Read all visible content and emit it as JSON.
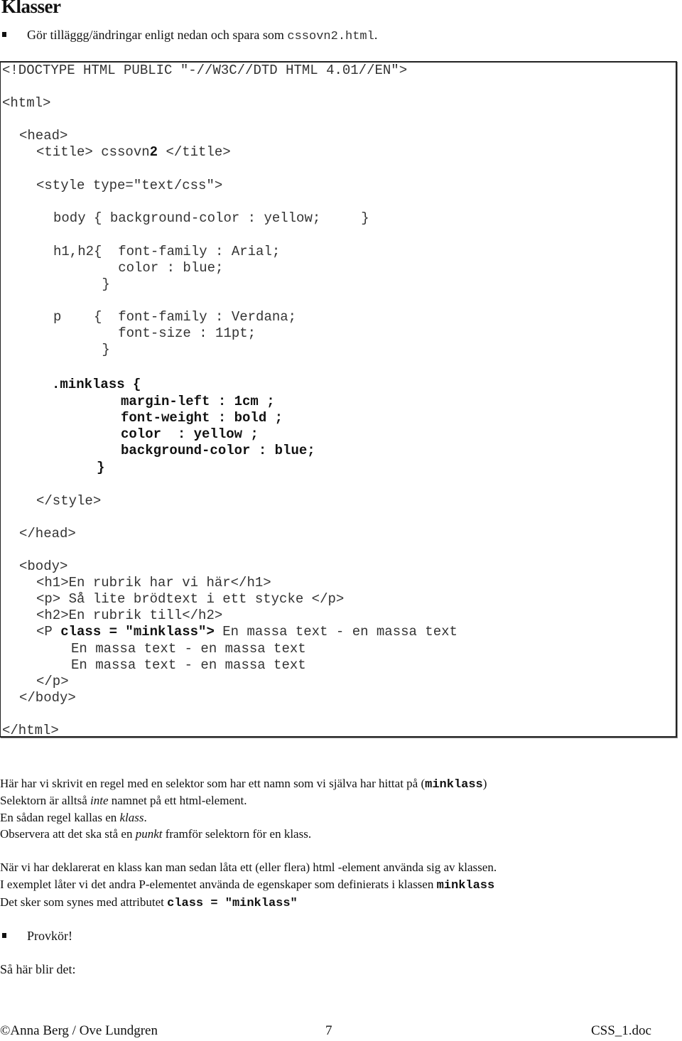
{
  "heading": "Klasser",
  "instruction": {
    "text": "Gör tilläggg/ändringar enligt nedan och spara som ",
    "filename": "cssovn2.html",
    "end": "."
  },
  "code": {
    "doctype": "<!DOCTYPE HTML PUBLIC \"-//W3C//DTD HTML 4.01//EN\">",
    "html_open": "<html>",
    "head_open": "<head>",
    "title_pre": "<title> cssovn",
    "title_bold": "2",
    "title_post": " </title>",
    "style_open": "<style type=\"text/css\">",
    "body_rule": "body { background-color : yellow;     }",
    "h_rule_1": "h1,h2{  font-family : Arial;",
    "h_rule_2": "        color : blue;",
    "h_rule_3": "      }",
    "p_rule_1": "p    {  font-family : Verdana;",
    "p_rule_2": "        font-size : 11pt;",
    "p_rule_3": "      }",
    "class_rule_1": ".minklass {",
    "class_rule_2": "margin-left : 1cm ;",
    "class_rule_3": "font-weight : bold ;",
    "class_rule_4": "color  : yellow ;",
    "class_rule_5": "background-color : blue;",
    "class_rule_6": "}",
    "style_close": "</style>",
    "head_close": "</head>",
    "body_open": "<body>",
    "h1_line": "<h1>En rubrik har vi här</h1>",
    "p_line": "<p> Så lite brödtext i ett stycke </p>",
    "h2_line": "<h2>En rubrik till</h2>",
    "pclass_pre": "<P ",
    "pclass_bold": "class = \"minklass\">",
    "pclass_post": " En massa text - en massa text",
    "text_line_2": "En massa text - en massa text",
    "text_line_3": "En massa text - en massa text",
    "p_close": "</p>",
    "body_close": "</body>",
    "html_close": "</html>"
  },
  "explanation": {
    "line1_pre": "Här har vi skrivit en regel med en selektor som har ett namn som vi själva har hittat på  (",
    "line1_code": "minklass",
    "line1_post": ")",
    "line2_pre": "Selektorn är alltså ",
    "line2_em": "inte",
    "line2_post": " namnet på ett html-element.",
    "line3_pre": "En sådan regel kallas en ",
    "line3_em": "klass",
    "line3_post": ".",
    "line4_pre": "Observera att det ska stå en ",
    "line4_em": "punkt",
    "line4_post": " framför selektorn för en klass.",
    "line5": "När vi har deklarerat en klass kan man sedan låta ett (eller flera) html -element använda sig av klassen.",
    "line6_pre": "I exemplet låter vi det andra P-elementet använda de egenskaper som definierats i klassen  ",
    "line6_code": "minklass",
    "line7_pre": "Det sker som synes med attributet ",
    "line7_code": "class = \"minklass\""
  },
  "run_bullet": "Provkör!",
  "result_label": "Så här blir det:",
  "footer": {
    "left": "©Anna Berg / Ove Lundgren",
    "page": "7",
    "right": "CSS_1.doc"
  }
}
